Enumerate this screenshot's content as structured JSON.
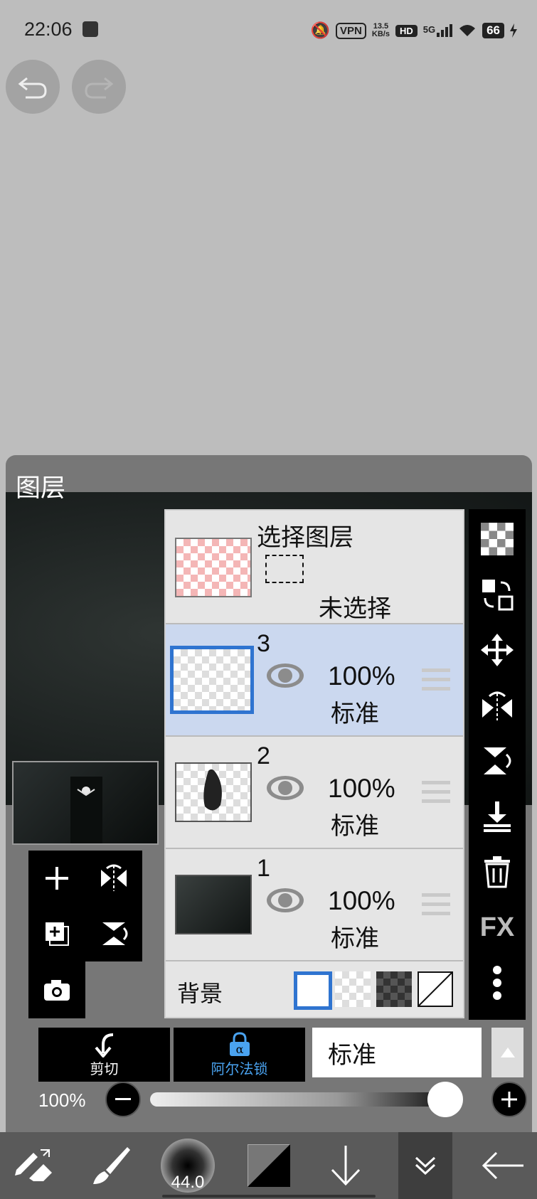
{
  "status": {
    "time": "22:06",
    "vpn": "VPN",
    "speed_value": "13.5",
    "speed_unit": "KB/s",
    "hd": "HD",
    "network": "5G",
    "battery": "66"
  },
  "panel": {
    "title": "图层"
  },
  "selection_layer": {
    "title": "选择图层",
    "status": "未选择"
  },
  "layers": [
    {
      "number": "3",
      "opacity": "100%",
      "mode": "标准"
    },
    {
      "number": "2",
      "opacity": "100%",
      "mode": "标准"
    },
    {
      "number": "1",
      "opacity": "100%",
      "mode": "标准"
    }
  ],
  "background": {
    "label": "背景"
  },
  "right_toolbar": {
    "fx_label": "FX"
  },
  "actions": {
    "clip_label": "剪切",
    "alpha_lock_label": "阿尔法锁",
    "blend_mode": "标准"
  },
  "opacity": {
    "label": "100%",
    "value": 1.0
  },
  "bottom_toolbar": {
    "brush_size": "44.0"
  },
  "colors": {
    "accent": "#2f74d0",
    "active_layer_bg": "#cbd8ef",
    "alpha_lock_text": "#4aa3f0"
  }
}
